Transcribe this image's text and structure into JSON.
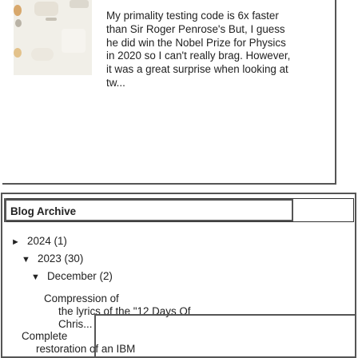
{
  "post": {
    "thumbnail_icon": "photo-thumbnail-icon",
    "excerpt": "My primality testing code is 6x faster than Sir Roger Penrose's But, I guess he did win the Nobel Prize for Physics in 2020 so I can't really brag. However, it was a great surprise when looking at tw..."
  },
  "archive": {
    "title": "Blog Archive",
    "years": [
      {
        "toggle": "►",
        "label": "2024 (1)"
      },
      {
        "toggle": "▼",
        "label": "2023 (30)"
      }
    ],
    "month": {
      "toggle": "▼",
      "label": "December (2)"
    },
    "posts": [
      {
        "title": "Compression of",
        "desc": "the lyrics of the \"12 Days Of Chris..."
      },
      {
        "title": "Complete",
        "desc": "restoration of an IBM"
      }
    ]
  }
}
